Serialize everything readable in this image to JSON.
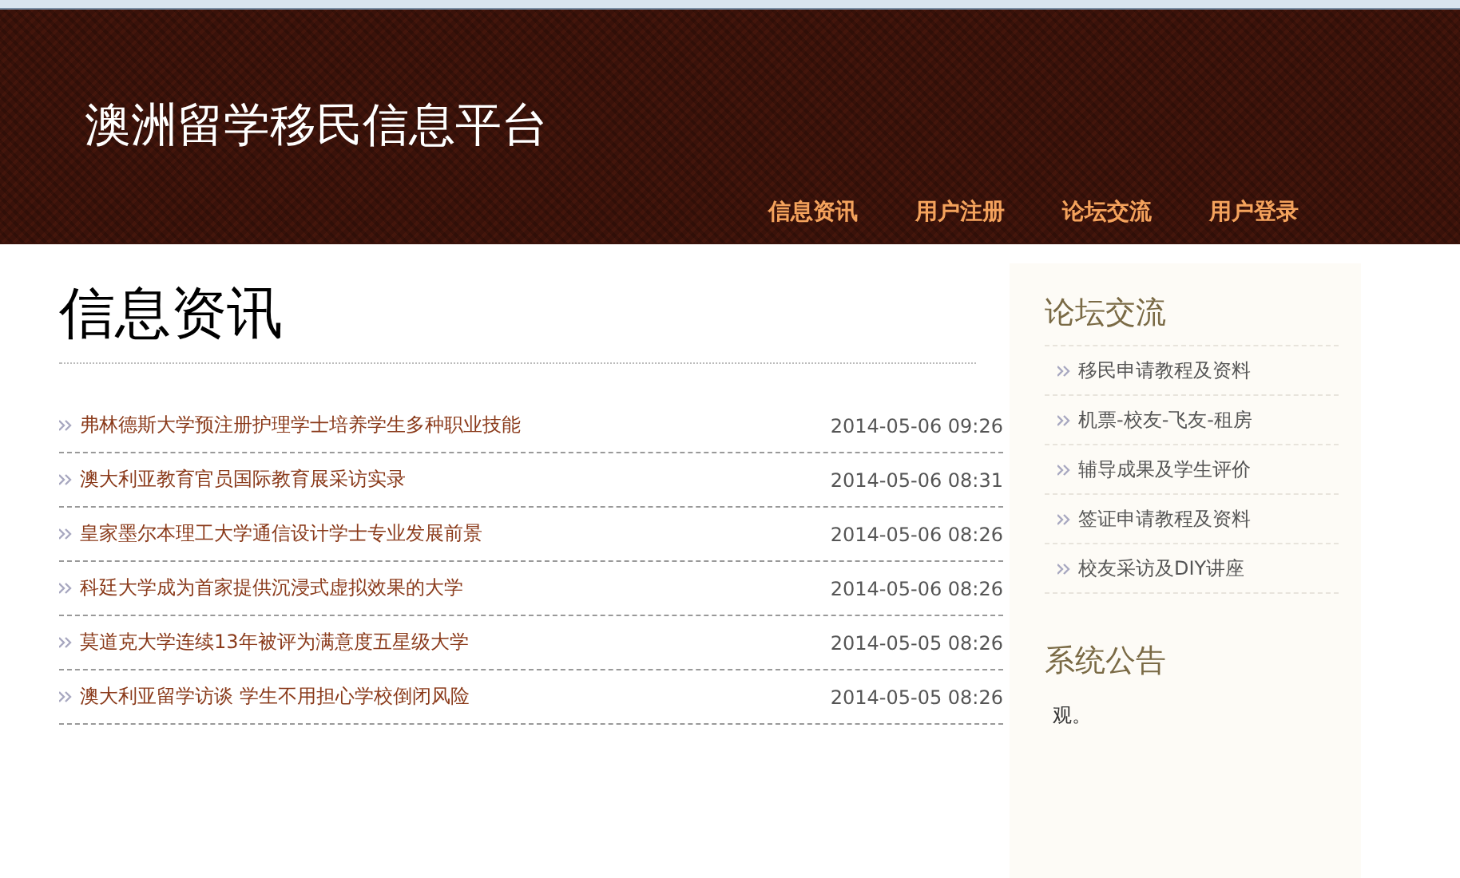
{
  "header": {
    "site_title": "澳洲留学移民信息平台",
    "nav": [
      {
        "label": "信息资讯"
      },
      {
        "label": "用户注册"
      },
      {
        "label": "论坛交流"
      },
      {
        "label": "用户登录"
      }
    ]
  },
  "main": {
    "heading": "信息资讯",
    "news": [
      {
        "title": "弗林德斯大学预注册护理学士培养学生多种职业技能",
        "date": "2014-05-06 09:26"
      },
      {
        "title": "澳大利亚教育官员国际教育展采访实录",
        "date": "2014-05-06 08:31"
      },
      {
        "title": "皇家墨尔本理工大学通信设计学士专业发展前景",
        "date": "2014-05-06 08:26"
      },
      {
        "title": "科廷大学成为首家提供沉浸式虚拟效果的大学",
        "date": "2014-05-06 08:26"
      },
      {
        "title": "莫道克大学连续13年被评为满意度五星级大学",
        "date": "2014-05-05 08:26"
      },
      {
        "title": "澳大利亚留学访谈 学生不用担心学校倒闭风险",
        "date": "2014-05-05 08:26"
      }
    ]
  },
  "sidebar": {
    "forum_heading": "论坛交流",
    "forum_links": [
      {
        "label": "移民申请教程及资料"
      },
      {
        "label": "机票-校友-飞友-租房"
      },
      {
        "label": "辅导成果及学生评价"
      },
      {
        "label": "签证申请教程及资料"
      },
      {
        "label": "校友采访及DIY讲座"
      }
    ],
    "notice_heading": "系统公告",
    "notice_text": "观。"
  }
}
